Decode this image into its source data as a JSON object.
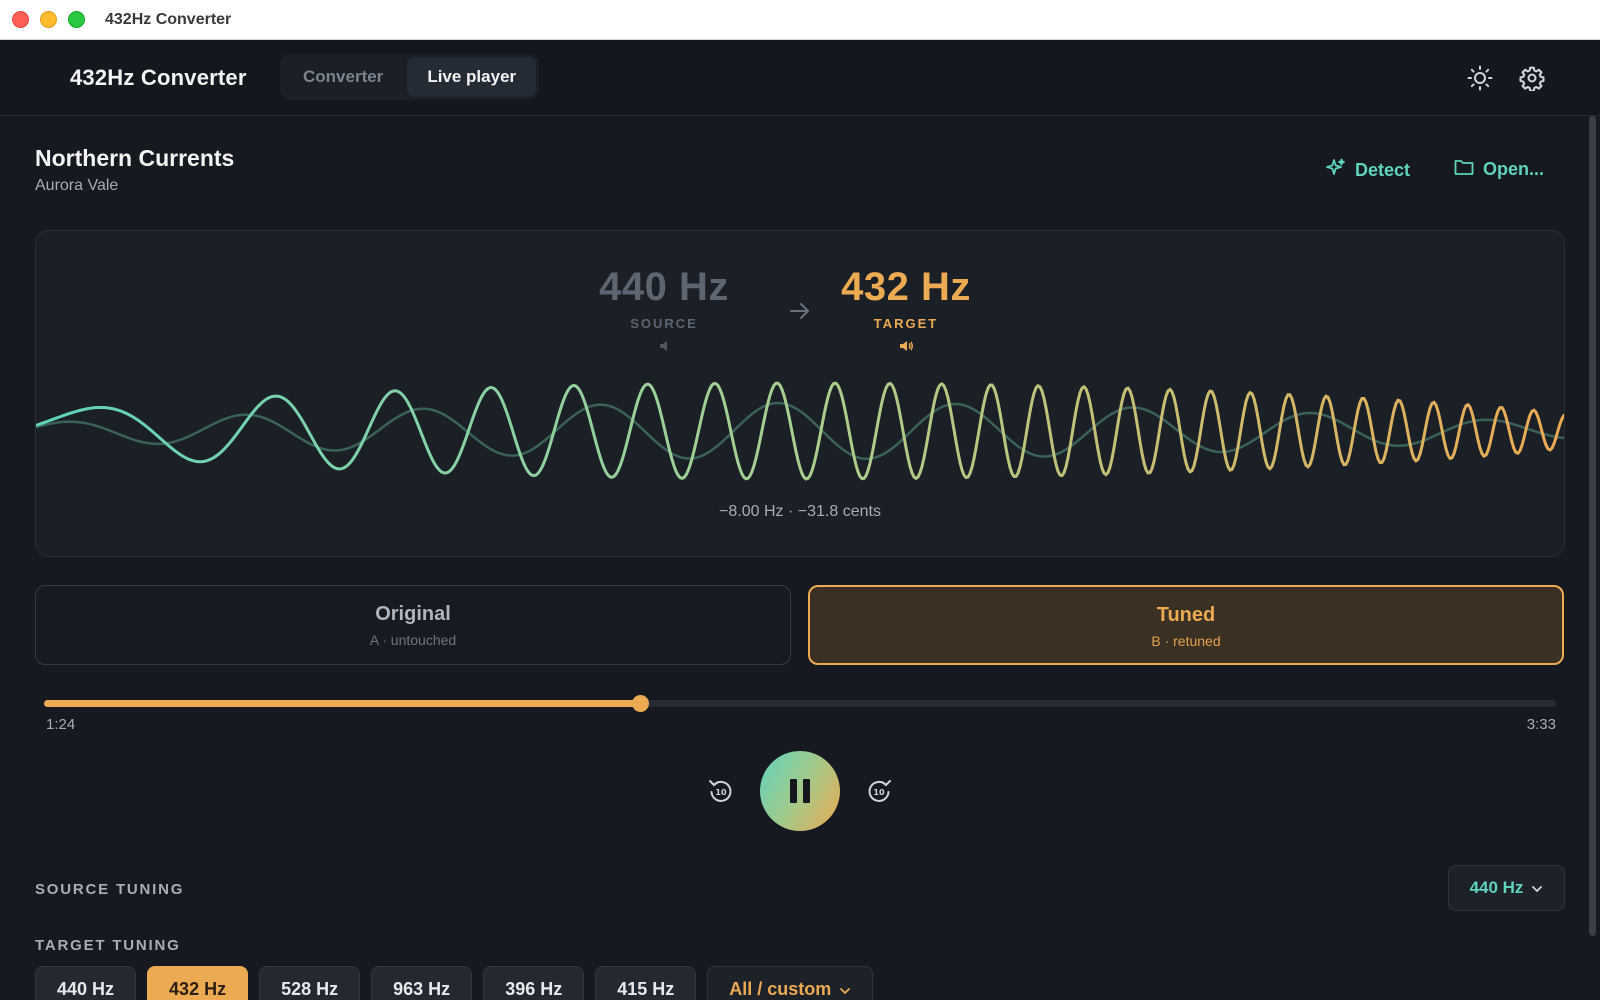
{
  "window": {
    "title": "432Hz Converter"
  },
  "header": {
    "app_name": "432Hz Converter",
    "tabs": [
      {
        "label": "Converter",
        "active": false
      },
      {
        "label": "Live player",
        "active": true
      }
    ],
    "icons": [
      "sun-icon",
      "gear-icon"
    ]
  },
  "track": {
    "title": "Northern Currents",
    "artist": "Aurora Vale"
  },
  "actions": {
    "detect_label": "Detect",
    "open_label": "Open..."
  },
  "conversion": {
    "source_value": "440 Hz",
    "source_label": "SOURCE",
    "target_value": "432 Hz",
    "target_label": "TARGET",
    "delta": "−8.00 Hz · −31.8 cents"
  },
  "ab": {
    "original": {
      "title": "Original",
      "subtitle": "A · untouched"
    },
    "tuned": {
      "title": "Tuned",
      "subtitle": "B · retuned",
      "selected": true
    }
  },
  "playback": {
    "current_time": "1:24",
    "total_time": "3:33",
    "progress": 0.394,
    "state": "playing"
  },
  "source_tuning": {
    "label": "SOURCE TUNING",
    "value": "440 Hz"
  },
  "target_tuning": {
    "label": "TARGET TUNING",
    "options": [
      "440 Hz",
      "432 Hz",
      "528 Hz",
      "963 Hz",
      "396 Hz",
      "415 Hz"
    ],
    "selected": "432 Hz",
    "custom_label": "All / custom"
  },
  "colors": {
    "accent_teal": "#5fd3bd",
    "accent_amber": "#ecaa52",
    "background": "#161a20",
    "panel": "#1b1f26"
  }
}
